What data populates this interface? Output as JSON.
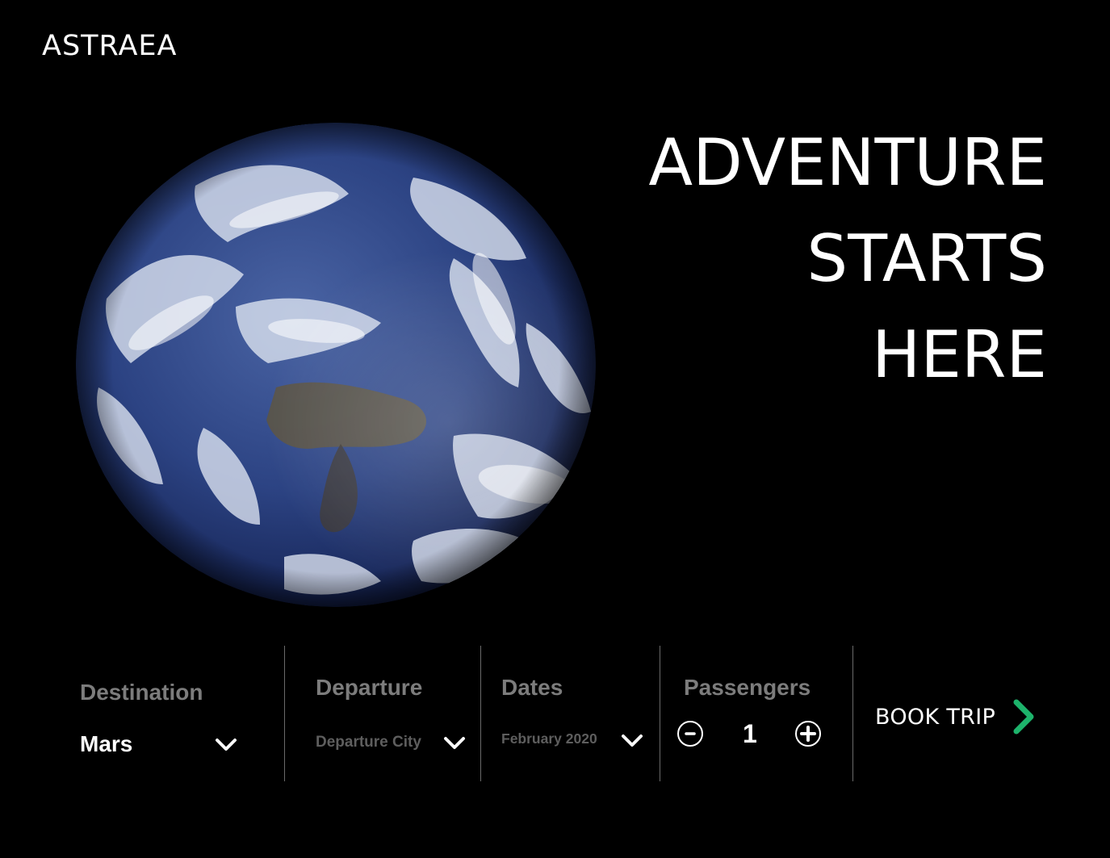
{
  "brand": {
    "name": "ASTRAEA"
  },
  "hero": {
    "image": "earth-from-space",
    "headline_lines": [
      "ADVENTURE",
      "STARTS",
      "HERE"
    ]
  },
  "booking": {
    "destination": {
      "label": "Destination",
      "value": "Mars"
    },
    "departure": {
      "label": "Departure",
      "placeholder": "Departure City"
    },
    "dates": {
      "label": "Dates",
      "value": "February 2020"
    },
    "passengers": {
      "label": "Passengers",
      "count": "1",
      "decrement": "-",
      "increment": "+"
    },
    "submit": {
      "label": "BOOK TRIP",
      "accent": "#1db36b"
    }
  },
  "colors": {
    "background": "#000000",
    "text": "#ffffff",
    "muted_label": "#7c7c7c",
    "muted_value": "#5e5e5e",
    "divider": "#6a6a6a",
    "accent": "#1db36b"
  }
}
